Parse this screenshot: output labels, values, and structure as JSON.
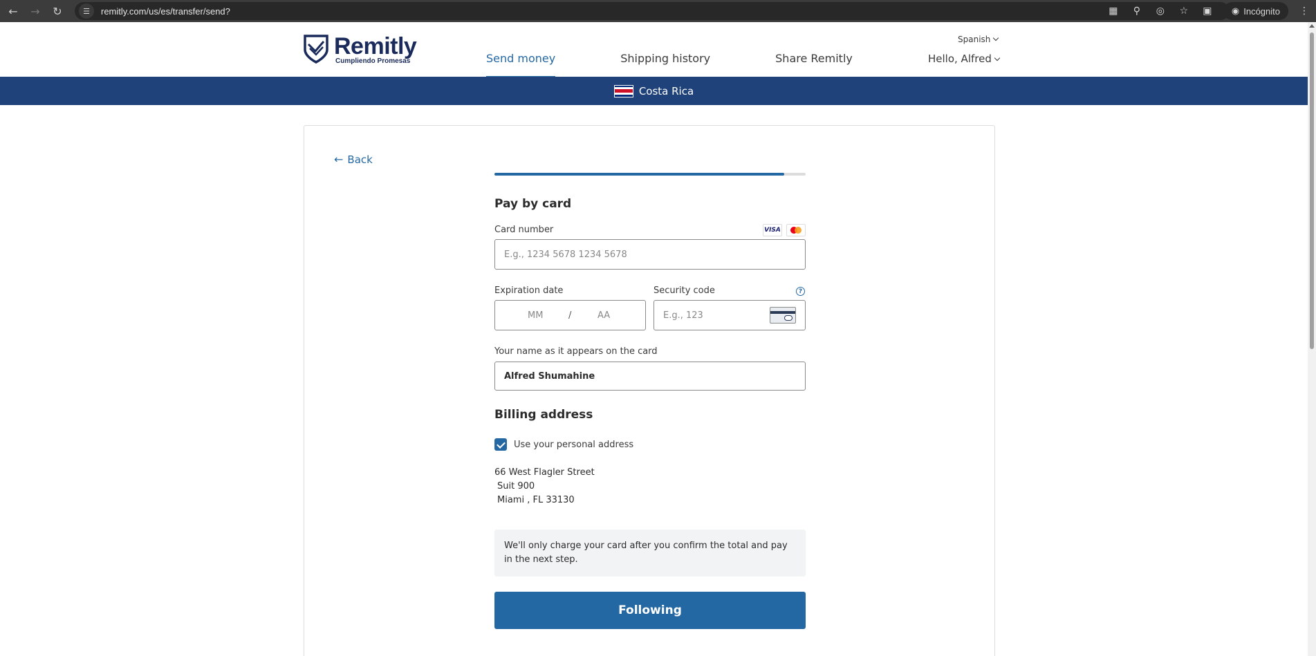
{
  "browser": {
    "url": "remitly.com/us/es/transfer/send?",
    "incognito_label": "Incógnito"
  },
  "header": {
    "brand": "Remitly",
    "tagline": "Cumpliendo Promesas",
    "nav": [
      {
        "label": "Send money",
        "active": true
      },
      {
        "label": "Shipping history",
        "active": false
      },
      {
        "label": "Share Remitly",
        "active": false
      }
    ],
    "language": "Spanish",
    "greeting": "Hello, Alfred"
  },
  "banner": {
    "country": "Costa Rica"
  },
  "form": {
    "back_label": "Back",
    "progress": 0.93,
    "title": "Pay by card",
    "card_number_label": "Card number",
    "card_number_placeholder": "E.g., 1234 5678 1234 5678",
    "card_brands": [
      "VISA",
      "Mastercard"
    ],
    "expiration_label": "Expiration date",
    "exp_month_placeholder": "MM",
    "exp_separator": "/",
    "exp_year_placeholder": "AA",
    "security_label": "Security code",
    "security_help": "?",
    "security_placeholder": "E.g., 123",
    "name_label": "Your name as it appears on the card",
    "name_value": "Alfred Shumahine",
    "billing_title": "Billing address",
    "use_personal_label": "Use your personal address",
    "use_personal_checked": true,
    "address": {
      "line1": "66 West Flagler Street",
      "line2": "Suit 900",
      "line3": "Miami , FL   33130"
    },
    "notice": "We'll only charge your card after you confirm the total and pay in the next step.",
    "submit_label": "Following"
  },
  "colors": {
    "primary": "#2468a3",
    "banner": "#1e4279",
    "brand": "#1a2a5a"
  }
}
